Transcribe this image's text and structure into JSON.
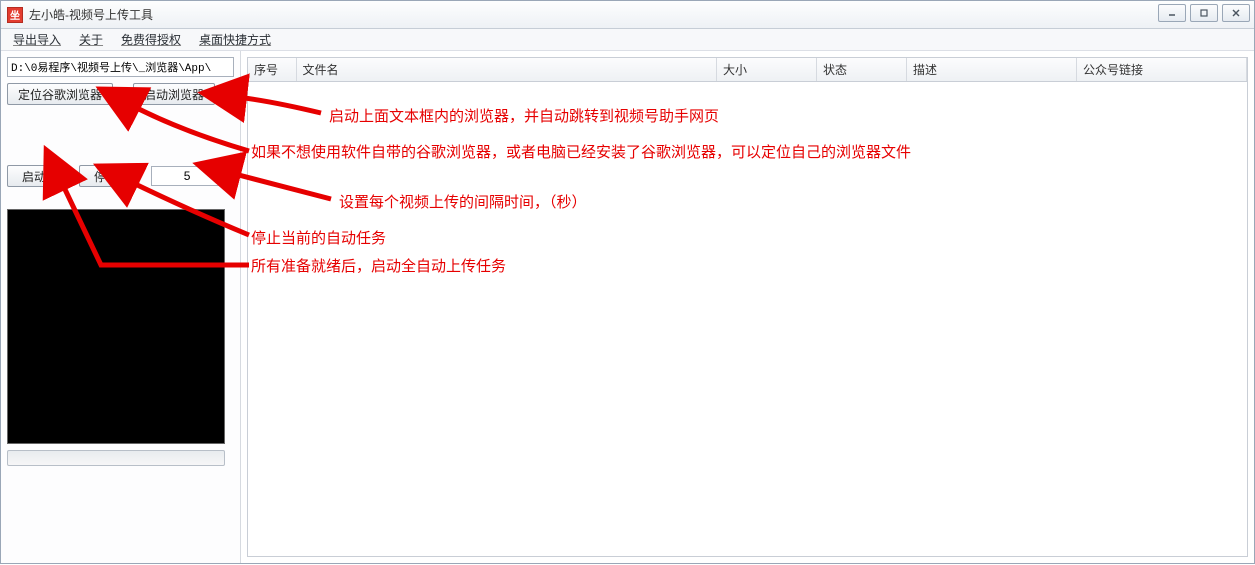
{
  "window": {
    "title": "左小皓-视频号上传工具"
  },
  "menu": {
    "export_import": "导出导入",
    "about": "关于",
    "free_auth": "免费得授权",
    "desktop_shortcut": "桌面快捷方式"
  },
  "left": {
    "path_value": "D:\\0易程序\\视频号上传\\_浏览器\\App\\",
    "locate_browser": "定位谷歌浏览器",
    "launch_browser": "启动浏览器",
    "start": "启动",
    "stop": "停止",
    "interval_value": "5"
  },
  "table": {
    "columns": [
      "序号",
      "文件名",
      "大小",
      "状态",
      "描述",
      "公众号链接"
    ]
  },
  "annotations": {
    "a1": "启动上面文本框内的浏览器，并自动跳转到视频号助手网页",
    "a2": "如果不想使用软件自带的谷歌浏览器，或者电脑已经安装了谷歌浏览器，可以定位自己的浏览器文件",
    "a3": "设置每个视频上传的间隔时间，（秒）",
    "a4": "停止当前的自动任务",
    "a5": "所有准备就绪后，启动全自动上传任务"
  }
}
